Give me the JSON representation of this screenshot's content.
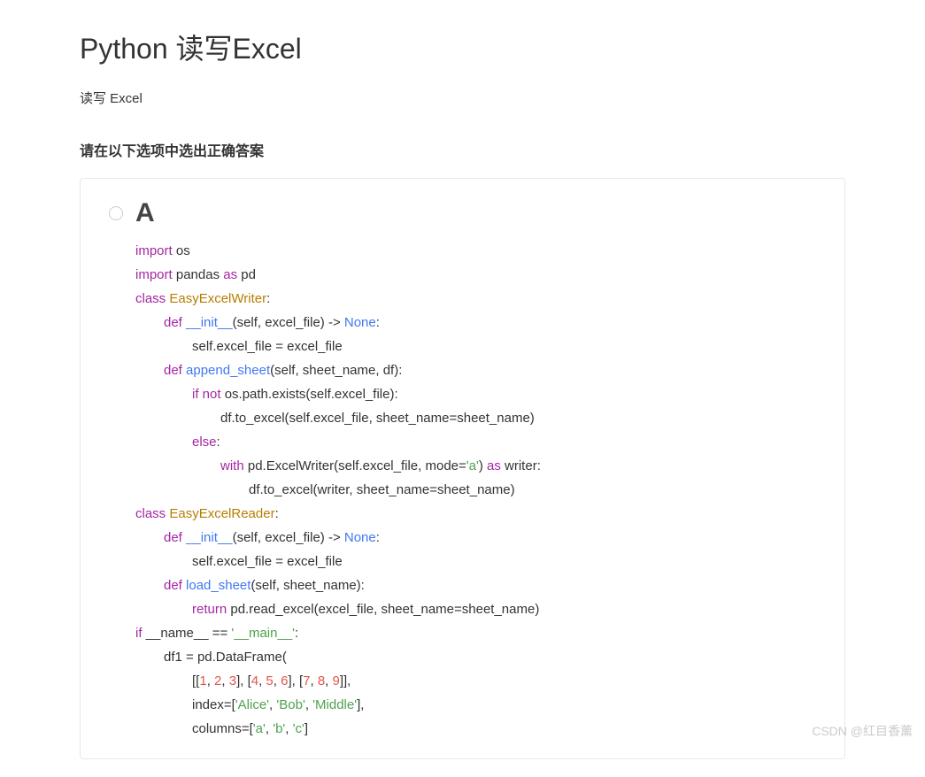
{
  "title": "Python 读写Excel",
  "subtitle": "读写 Excel",
  "instruction": "请在以下选项中选出正确答案",
  "option_letter": "A",
  "code": {
    "l1": {
      "kw1": "import",
      "t1": " os"
    },
    "l2": {
      "kw1": "import",
      "t1": " pandas ",
      "kw2": "as",
      "t2": " pd"
    },
    "l3": {
      "kw1": "class ",
      "cls": "EasyExcelWriter",
      "t1": ":"
    },
    "l4": {
      "kw1": "def ",
      "fn": "__init__",
      "t1": "(self, excel_file) -> ",
      "none": "None",
      "t2": ":"
    },
    "l5": {
      "t1": "self.excel_file = excel_file"
    },
    "l6": {
      "kw1": "def ",
      "fn": "append_sheet",
      "t1": "(self, sheet_name, df):"
    },
    "l7": {
      "kw1": "if not",
      "t1": " os.path.exists(self.excel_file):"
    },
    "l8": {
      "t1": "df.to_excel(self.excel_file, sheet_name=sheet_name)"
    },
    "l9": {
      "kw1": "else",
      "t1": ":"
    },
    "l10": {
      "kw1": "with",
      "t1": " pd.ExcelWriter(self.excel_file, mode=",
      "str": "'a'",
      "t2": ") ",
      "kw2": "as",
      "t3": " writer:"
    },
    "l11": {
      "t1": "df.to_excel(writer, sheet_name=sheet_name)"
    },
    "l12": {
      "kw1": "class ",
      "cls": "EasyExcelReader",
      "t1": ":"
    },
    "l13": {
      "kw1": "def ",
      "fn": "__init__",
      "t1": "(self, excel_file) -> ",
      "none": "None",
      "t2": ":"
    },
    "l14": {
      "t1": "self.excel_file = excel_file"
    },
    "l15": {
      "kw1": "def ",
      "fn": "load_sheet",
      "t1": "(self, sheet_name):"
    },
    "l16": {
      "kw1": "return",
      "t1": " pd.read_excel(excel_file, sheet_name=sheet_name)"
    },
    "l17": {
      "kw1": "if",
      "t1": " __name__ == ",
      "str": "'__main__'",
      "t2": ":"
    },
    "l18": {
      "t1": "df1 = pd.DataFrame("
    },
    "l19": {
      "t1": "[[",
      "n1": "1",
      "t2": ", ",
      "n2": "2",
      "t3": ", ",
      "n3": "3",
      "t4": "], [",
      "n4": "4",
      "t5": ", ",
      "n5": "5",
      "t6": ", ",
      "n6": "6",
      "t7": "], [",
      "n7": "7",
      "t8": ", ",
      "n8": "8",
      "t9": ", ",
      "n9": "9",
      "t10": "]],"
    },
    "l20": {
      "t1": "index=[",
      "s1": "'Alice'",
      "t2": ", ",
      "s2": "'Bob'",
      "t3": ", ",
      "s3": "'Middle'",
      "t4": "],"
    },
    "l21": {
      "t1": "columns=[",
      "s1": "'a'",
      "t2": ", ",
      "s2": "'b'",
      "t3": ", ",
      "s3": "'c'",
      "t4": "]"
    }
  },
  "watermark": "CSDN @红目香薰"
}
